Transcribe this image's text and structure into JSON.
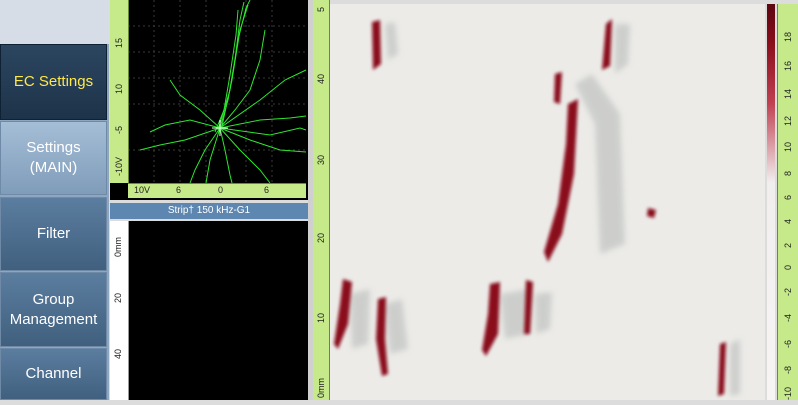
{
  "menu": {
    "items": [
      {
        "label": "EC Settings",
        "state": "active"
      },
      {
        "label": "Settings\n(MAIN)",
        "state": "highlight"
      },
      {
        "label": "Filter",
        "state": "normal"
      },
      {
        "label": "Group\nManagement",
        "state": "normal"
      },
      {
        "label": "Channel",
        "state": "normal"
      }
    ]
  },
  "lissajous": {
    "v_ticks": [
      "15",
      "10",
      "-5",
      "-10V"
    ],
    "h_ticks": [
      "10V",
      "6",
      "0",
      "6"
    ],
    "trace_color": "#33ff33"
  },
  "strip": {
    "label": "Strip† 150 kHz-G1",
    "v_ticks": [
      "0mm",
      "20",
      "40"
    ]
  },
  "cscan": {
    "v_ticks": [
      "5",
      "40",
      "30",
      "20",
      "10",
      "0mm"
    ],
    "scale_ticks": [
      "18",
      "16",
      "14",
      "12",
      "10",
      "8",
      "6",
      "4",
      "2",
      "0",
      "-2",
      "-4",
      "-6",
      "-8",
      "-10"
    ],
    "colors": {
      "indication": "#8a0e1c",
      "background": "#ecebe8",
      "shadow": "#c8cac8"
    }
  }
}
